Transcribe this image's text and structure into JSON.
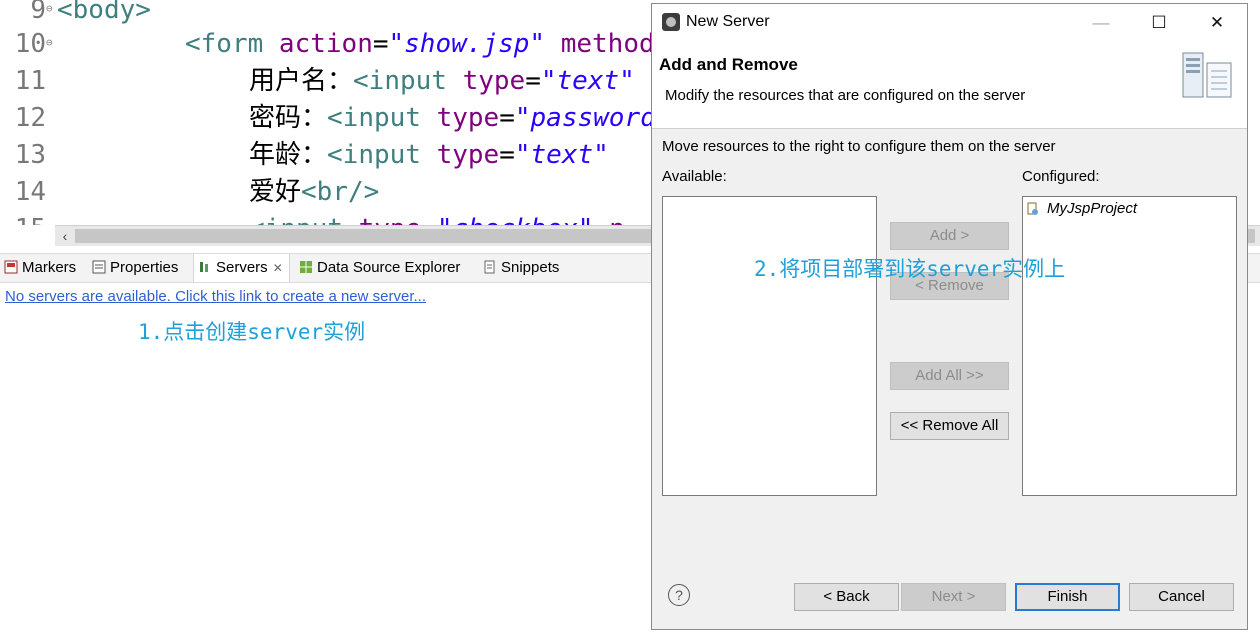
{
  "editor": {
    "lines": [
      {
        "num": "9",
        "tokens": [
          {
            "c": "tg",
            "t": "<body>"
          }
        ]
      },
      {
        "num": "10",
        "tokens": [
          {
            "c": "tg",
            "t": "<form "
          },
          {
            "c": "at",
            "t": "action"
          },
          {
            "c": "tx",
            "t": "="
          },
          {
            "c": "st",
            "t": "\"show.jsp\""
          },
          {
            "c": "tx",
            "t": " "
          },
          {
            "c": "at",
            "t": "method"
          }
        ]
      },
      {
        "num": "11",
        "tokens": [
          {
            "c": "tx",
            "t": "用户名："
          },
          {
            "c": "tg",
            "t": "<input "
          },
          {
            "c": "at",
            "t": "type"
          },
          {
            "c": "tx",
            "t": "="
          },
          {
            "c": "st",
            "t": "\"text\""
          }
        ]
      },
      {
        "num": "12",
        "tokens": [
          {
            "c": "tx",
            "t": "密码："
          },
          {
            "c": "tg",
            "t": "<input "
          },
          {
            "c": "at",
            "t": "type"
          },
          {
            "c": "tx",
            "t": "="
          },
          {
            "c": "st",
            "t": "\"password\""
          }
        ]
      },
      {
        "num": "13",
        "tokens": [
          {
            "c": "tx",
            "t": "年龄："
          },
          {
            "c": "tg",
            "t": "<input "
          },
          {
            "c": "at",
            "t": "type"
          },
          {
            "c": "tx",
            "t": "="
          },
          {
            "c": "st",
            "t": "\"text\""
          }
        ]
      },
      {
        "num": "14",
        "tokens": [
          {
            "c": "tx",
            "t": "爱好"
          },
          {
            "c": "tg",
            "t": "<br/>"
          }
        ]
      },
      {
        "num": "15",
        "tokens": [
          {
            "c": "tg",
            "t": "<input "
          },
          {
            "c": "at",
            "t": "type"
          },
          {
            "c": "tx",
            "t": "="
          },
          {
            "c": "st",
            "t": "\"checkbox\""
          },
          {
            "c": "tx",
            "t": " "
          },
          {
            "c": "at",
            "t": "n"
          }
        ]
      }
    ]
  },
  "views": {
    "tabs": [
      {
        "label": "Markers",
        "icon": "markers-icon"
      },
      {
        "label": "Properties",
        "icon": "properties-icon"
      },
      {
        "label": "Servers",
        "icon": "servers-icon",
        "active": true
      },
      {
        "label": "Data Source Explorer",
        "icon": "data-source-icon"
      },
      {
        "label": "Snippets",
        "icon": "snippets-icon"
      }
    ],
    "close_glyph": "✕",
    "servers_link": "No servers are available. Click this link to create a new server..."
  },
  "annotations": {
    "step1": "1.点击创建server实例",
    "step2": "2.将项目部署到该server实例上"
  },
  "dialog": {
    "title": "New Server",
    "window_buttons": {
      "minimize": "—",
      "maximize": "☐",
      "close": "✕"
    },
    "header_title": "Add and Remove",
    "header_desc": "Modify the resources that are configured on the server",
    "instruction": "Move resources to the right to configure them on the server",
    "available_label": "Available:",
    "configured_label": "Configured:",
    "configured_items": [
      "MyJspProject"
    ],
    "buttons": {
      "add": "Add >",
      "remove": "< Remove",
      "add_all": "Add All >>",
      "remove_all": "<< Remove All"
    },
    "footer": {
      "help": "?",
      "back": "< Back",
      "next": "Next >",
      "finish": "Finish",
      "cancel": "Cancel"
    }
  }
}
